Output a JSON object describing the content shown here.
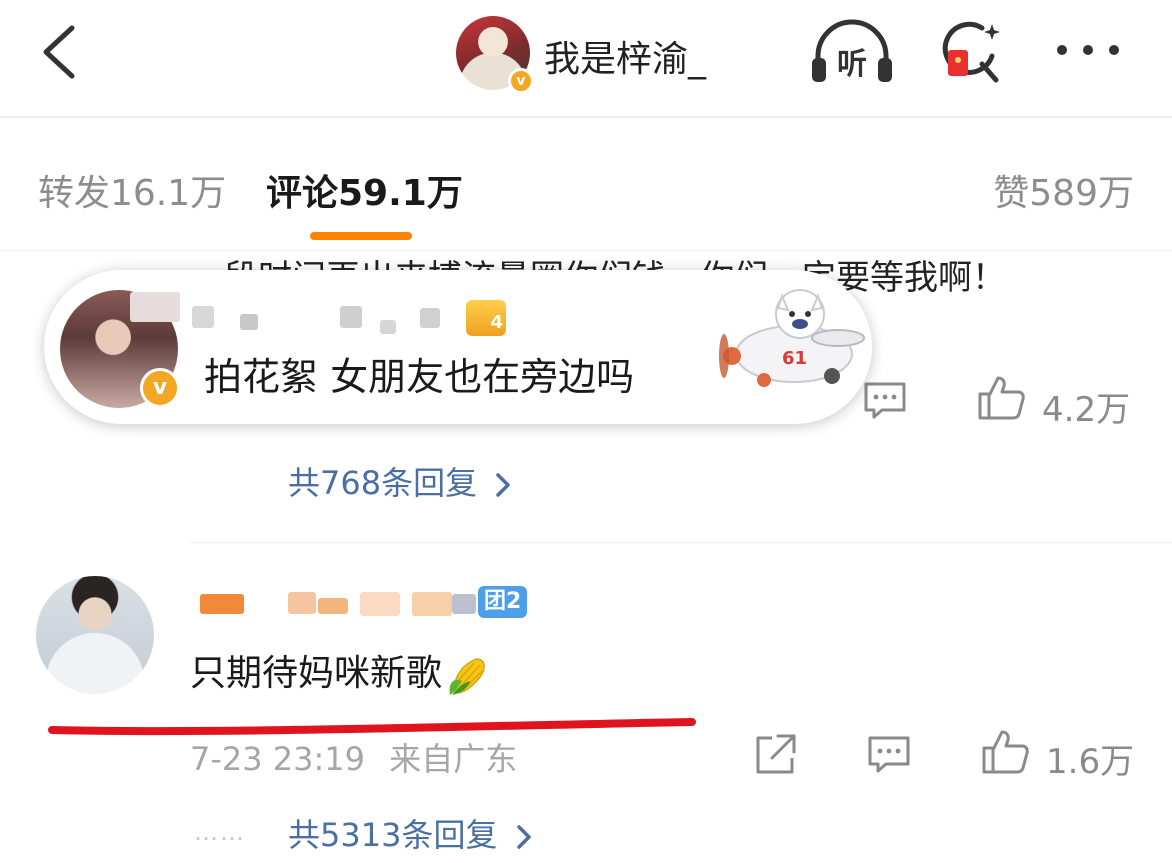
{
  "header": {
    "account_name": "我是梓渝_",
    "verified_mark": "v",
    "listen_label": "听"
  },
  "tabs": {
    "repost": "转发16.1万",
    "comment": "评论59.1万",
    "like": "赞589万"
  },
  "comment1": {
    "text": "一段时间再出来搏流量圈你们钱，你们一定要等我啊！",
    "like_count": "4.2万",
    "replies": "共768条回复"
  },
  "popup": {
    "text": "拍花絮 女朋友也在旁边吗",
    "level": "4",
    "verified_mark": "v",
    "sticker_number": "61"
  },
  "comment2": {
    "text": "只期待妈咪新歌",
    "vip_tag": "团2",
    "timestamp": "7-23 23:19",
    "location": "来自广东",
    "like_count": "1.6万",
    "replies": "共5313条回复",
    "dots": "……"
  },
  "colors": {
    "accent_orange": "#ff8200",
    "link_blue": "#4a6fa5",
    "underline_red": "#e0141e",
    "verified_gold": "#f5a623"
  },
  "icons": [
    "back-arrow-icon",
    "listen-icon",
    "red-packet-search-icon",
    "more-icon",
    "comment-icon",
    "thumbs-up-icon",
    "share-icon",
    "chevron-right-icon",
    "corn-emoji-icon"
  ]
}
